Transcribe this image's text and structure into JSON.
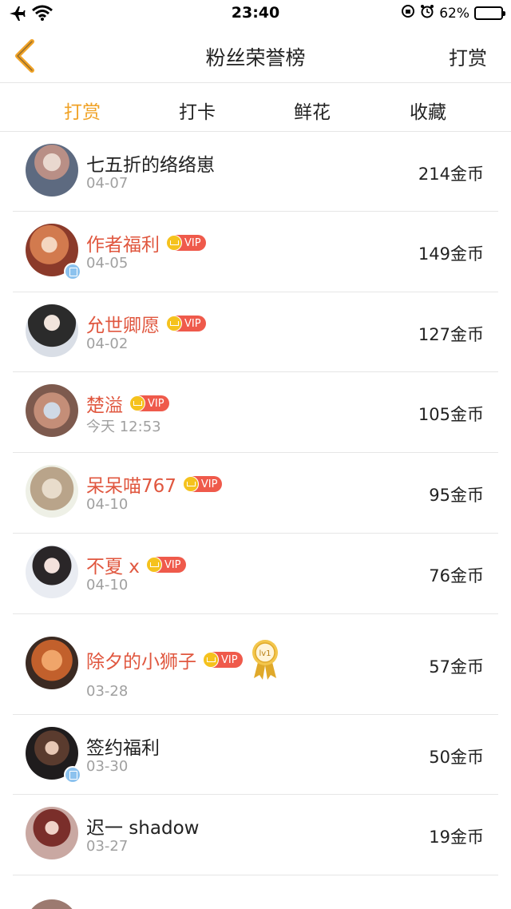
{
  "status_bar": {
    "time": "23:40",
    "battery_text": "62%",
    "battery_level": 0.62
  },
  "nav": {
    "title": "粉丝荣誉榜",
    "action_label": "打赏"
  },
  "tabs": [
    {
      "label": "打赏",
      "active": true
    },
    {
      "label": "打卡",
      "active": false
    },
    {
      "label": "鲜花",
      "active": false
    },
    {
      "label": "收藏",
      "active": false
    }
  ],
  "vip_label": "VIP",
  "level_label": "lv1",
  "colors": {
    "accent": "#f0a226",
    "vip_name": "#e0573f",
    "vip_badge": "#ef5a4b",
    "date_gray": "#a0a0a0"
  },
  "rows": [
    {
      "name": "七五折的络络崽",
      "date": "04-07",
      "amount": "214金币",
      "vip": false
    },
    {
      "name": "作者福利",
      "date": "04-05",
      "amount": "149金币",
      "vip": true
    },
    {
      "name": "允世卿愿",
      "date": "04-02",
      "amount": "127金币",
      "vip": true
    },
    {
      "name": "楚溢",
      "date": "今天 12:53",
      "amount": "105金币",
      "vip": true
    },
    {
      "name": "呆呆喵767",
      "date": "04-10",
      "amount": "95金币",
      "vip": true
    },
    {
      "name": "不夏 x",
      "date": "04-10",
      "amount": "76金币",
      "vip": true
    },
    {
      "name": "除夕的小狮子",
      "date": "03-28",
      "amount": "57金币",
      "vip": true,
      "level": true
    },
    {
      "name": "签约福利",
      "date": "03-30",
      "amount": "50金币",
      "vip": false
    },
    {
      "name": "迟一 shadow",
      "date": "03-27",
      "amount": "19金币",
      "vip": false
    }
  ]
}
